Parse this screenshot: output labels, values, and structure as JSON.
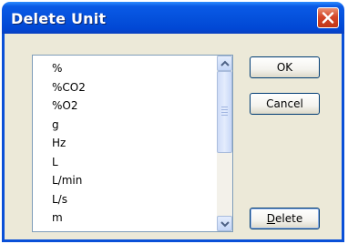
{
  "window": {
    "title": "Delete Unit"
  },
  "list": {
    "items": [
      "%",
      "%CO2",
      "%O2",
      "g",
      "Hz",
      "L",
      "L/min",
      "L/s",
      "m"
    ]
  },
  "buttons": {
    "ok": "OK",
    "cancel": "Cancel",
    "delete_mnemonic": "D",
    "delete_rest": "elete"
  },
  "icons": {
    "close": "close-icon",
    "scroll_up": "chevron-up-icon",
    "scroll_down": "chevron-down-icon",
    "scroll_grip": "grip-icon"
  },
  "colors": {
    "titlebar": "#0551dc",
    "dialog_bg": "#ece9d8",
    "close_button": "#d4472a"
  }
}
